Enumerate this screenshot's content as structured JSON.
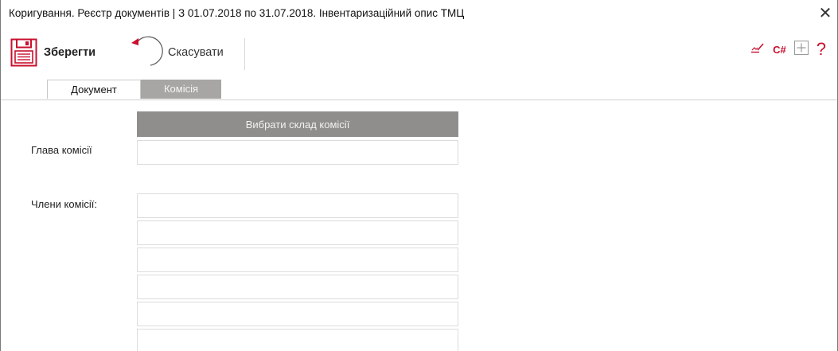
{
  "window": {
    "title": "Коригування. Реєстр документів |  З 01.07.2018 по 31.07.2018. Інвентаризаційний опис ТМЦ",
    "close_glyph": "✕"
  },
  "toolbar": {
    "save_label": "Зберегти",
    "cancel_label": "Скасувати",
    "csharp_label": "C#",
    "help_label": "?",
    "accent_color": "#c8102e",
    "icons": [
      "floppy-disk-icon",
      "undo-arrow-icon",
      "signature-icon",
      "plus-box-icon"
    ]
  },
  "tabs": [
    {
      "label": "Документ",
      "active": false
    },
    {
      "label": "Комісія",
      "active": true
    }
  ],
  "commission": {
    "select_button_label": "Вибрати склад комісії",
    "head_label": "Глава комісії",
    "head_value": "",
    "members_label": "Члени комісії:",
    "members": [
      "",
      "",
      "",
      "",
      "",
      ""
    ]
  }
}
